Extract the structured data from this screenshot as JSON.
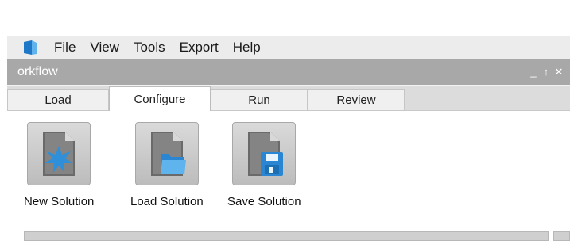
{
  "menubar": {
    "logo_icon": "app-logo-icon",
    "items": [
      "File",
      "View",
      "Tools",
      "Export",
      "Help"
    ]
  },
  "panel": {
    "title": "orkflow",
    "controls": [
      "_",
      "↑",
      "✕"
    ]
  },
  "tabs": [
    {
      "label": "Load",
      "active": false
    },
    {
      "label": "Configure",
      "active": true
    },
    {
      "label": "Run",
      "active": false
    },
    {
      "label": "Review",
      "active": false
    }
  ],
  "tools": [
    {
      "label": "New Solution",
      "icon": "new-solution-icon"
    },
    {
      "label": "Load Solution",
      "icon": "load-solution-icon"
    },
    {
      "label": "Save Solution",
      "icon": "save-solution-icon"
    }
  ],
  "colors": {
    "panel_title_bg": "#a8a8a8",
    "accent_blue": "#2f8fd8"
  }
}
